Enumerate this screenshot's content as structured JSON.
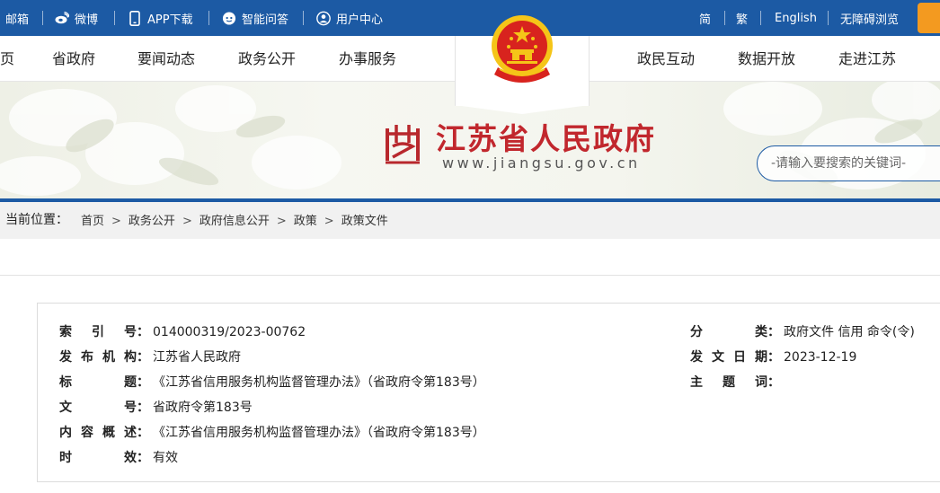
{
  "topbar": {
    "items": [
      {
        "label": "邮箱",
        "icon": "mail-icon"
      },
      {
        "label": "微博",
        "icon": "weibo-icon"
      },
      {
        "label": "APP下载",
        "icon": "phone-icon"
      },
      {
        "label": "智能问答",
        "icon": "chat-bot-icon"
      },
      {
        "label": "用户中心",
        "icon": "user-icon"
      }
    ],
    "right": [
      "简",
      "繁",
      "English",
      "无障碍浏览"
    ]
  },
  "nav": {
    "left": [
      "页",
      "省政府",
      "要闻动态",
      "政务公开",
      "办事服务"
    ],
    "right": [
      "政民互动",
      "数据开放",
      "走进江苏"
    ]
  },
  "banner": {
    "title": "江苏省人民政府",
    "url": "www.jiangsu.gov.cn",
    "search_placeholder": "-请输入要搜索的关键词-"
  },
  "breadcrumb": {
    "label": "当前位置：",
    "items": [
      "首页",
      "政务公开",
      "政府信息公开",
      "政策",
      "政策文件"
    ],
    "separator": ">"
  },
  "info": {
    "index_label": "索引号",
    "index_value": "014000319/2023-00762",
    "publisher_label": "发布机构",
    "publisher_value": "江苏省人民政府",
    "title_label": "标题",
    "title_value": "《江苏省信用服务机构监督管理办法》（省政府令第183号）",
    "docno_label": "文号",
    "docno_value": "省政府令第183号",
    "summary_label": "内容概述",
    "summary_value": "《江苏省信用服务机构监督管理办法》（省政府令第183号）",
    "validity_label": "时效",
    "validity_value": "有效",
    "category_label": "分类",
    "category_value": "政府文件 信用 命令(令)",
    "date_label": "发文日期",
    "date_value": "2023-12-19",
    "subject_label": "主题词",
    "subject_value": "",
    "colon": "："
  },
  "colors": {
    "primary": "#1c5aa4",
    "title_red": "#c1272d",
    "accent_orange": "#f39a20"
  }
}
